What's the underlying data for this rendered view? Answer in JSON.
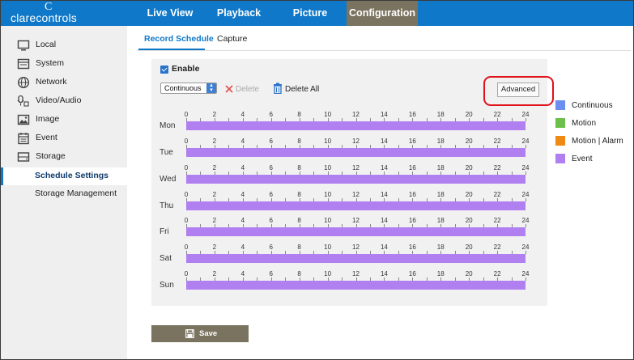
{
  "header": {
    "logo_mark": "C",
    "logo_text": "clarecontrols",
    "tabs": [
      {
        "label": "Live View"
      },
      {
        "label": "Playback"
      },
      {
        "label": "Picture"
      },
      {
        "label": "Configuration",
        "active": true
      }
    ],
    "accent_color": "#0f78c8",
    "active_tab_color": "#7a735f"
  },
  "sidebar": {
    "items": [
      {
        "label": "Local",
        "icon": "monitor-icon"
      },
      {
        "label": "System",
        "icon": "system-icon"
      },
      {
        "label": "Network",
        "icon": "globe-icon"
      },
      {
        "label": "Video/Audio",
        "icon": "mic-video-icon"
      },
      {
        "label": "Image",
        "icon": "image-icon"
      },
      {
        "label": "Event",
        "icon": "calendar-icon"
      },
      {
        "label": "Storage",
        "icon": "storage-icon"
      },
      {
        "label": "Schedule Settings",
        "active": true
      },
      {
        "label": "Storage Management"
      }
    ]
  },
  "subtabs": [
    {
      "label": "Record Schedule",
      "active": true
    },
    {
      "label": "Capture"
    }
  ],
  "toolbar": {
    "enable_label": "Enable",
    "enable_checked": true,
    "record_type_value": "Continuous",
    "delete_label": "Delete",
    "delete_all_label": "Delete All",
    "advanced_label": "Advanced"
  },
  "schedule": {
    "hour_ticks": [
      "0",
      "2",
      "4",
      "6",
      "8",
      "10",
      "12",
      "14",
      "16",
      "18",
      "20",
      "22",
      "24"
    ],
    "days": [
      {
        "label": "Mon",
        "type": "Event",
        "from": 0,
        "to": 24
      },
      {
        "label": "Tue",
        "type": "Event",
        "from": 0,
        "to": 24
      },
      {
        "label": "Wed",
        "type": "Event",
        "from": 0,
        "to": 24
      },
      {
        "label": "Thu",
        "type": "Event",
        "from": 0,
        "to": 24
      },
      {
        "label": "Fri",
        "type": "Event",
        "from": 0,
        "to": 24
      },
      {
        "label": "Sat",
        "type": "Event",
        "from": 0,
        "to": 24
      },
      {
        "label": "Sun",
        "type": "Event",
        "from": 0,
        "to": 24
      }
    ]
  },
  "legend": [
    {
      "label": "Continuous",
      "color": "#6b8ff0"
    },
    {
      "label": "Motion",
      "color": "#6cc04a"
    },
    {
      "label": "Motion | Alarm",
      "color": "#ef8a14"
    },
    {
      "label": "Event",
      "color": "#b07ff0"
    }
  ],
  "footer": {
    "save_label": "Save"
  }
}
